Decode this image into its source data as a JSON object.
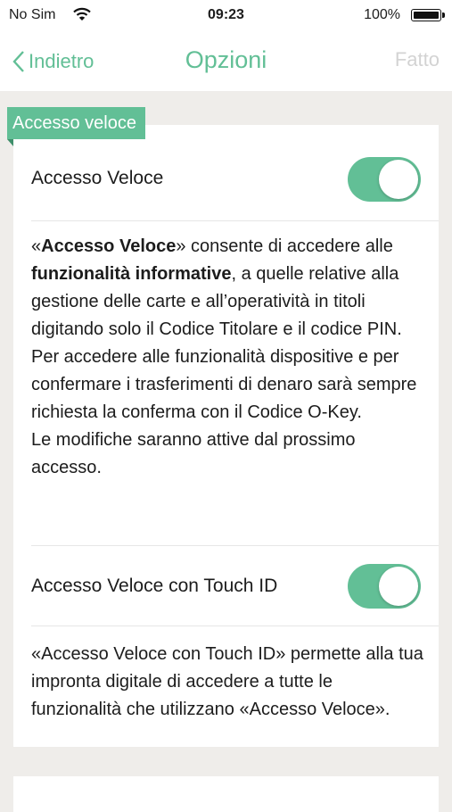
{
  "status_bar": {
    "carrier": "No Sim",
    "time": "09:23",
    "battery": "100%"
  },
  "nav": {
    "back_label": "Indietro",
    "title": "Opzioni",
    "done_label": "Fatto"
  },
  "section": {
    "tag": "Accesso veloce"
  },
  "quick_access": {
    "label": "Accesso Veloce",
    "enabled": true,
    "description": {
      "p1_open": "«",
      "p1_bold1": "Accesso Veloce",
      "p1_mid": "» consente di accedere alle ",
      "p1_bold2": "funzionalità informative",
      "p1_rest": ", a quelle relative alla gestione delle carte e all’operatività in titoli digitando solo il Codice Titolare e il codice PIN.",
      "p2": "Per accedere alle funzionalità dispositive e per confermare i trasferimenti di denaro sarà sempre richiesta la conferma con il Codice O-Key.",
      "p3": "Le modifiche saranno attive dal prossimo accesso."
    }
  },
  "touch_id": {
    "label": "Accesso Veloce con Touch ID",
    "enabled": true,
    "description": "«Accesso Veloce con Touch ID» permette alla tua impronta digitale di accedere a tutte le funzionalità che utilizzano «Accesso Veloce»."
  },
  "colors": {
    "accent": "#62bf96",
    "background": "#efedea",
    "disabled": "#d3d3d3"
  }
}
